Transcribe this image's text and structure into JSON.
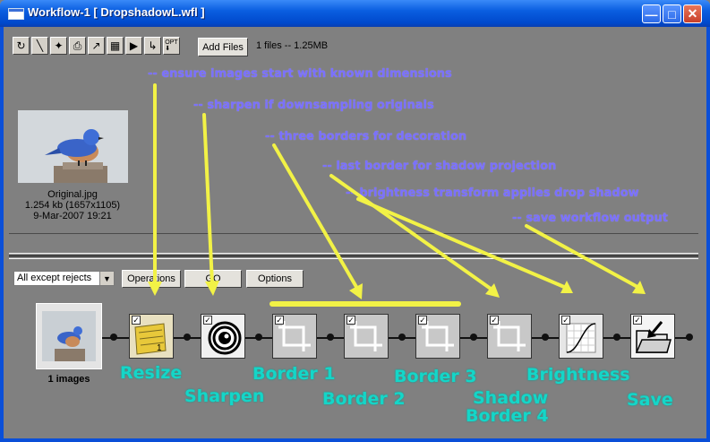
{
  "window": {
    "title": "Workflow-1 [ DropshadowL.wfl ]",
    "controls": [
      "minimize-icon",
      "maximize-icon",
      "close-icon"
    ]
  },
  "toolbar": {
    "tools": [
      "refresh-icon",
      "wand-icon",
      "tools-icon",
      "print-icon",
      "export-icon",
      "trash-icon",
      "play-icon",
      "step-icon",
      "options-icon"
    ],
    "add_files_label": "Add Files",
    "file_count": "1 files -- 1.25MB"
  },
  "annotations": [
    "-- ensure images start with known dimensions",
    "-- sharpen if downsampling originals",
    "-- three borders for decoration",
    "-- last border for shadow projection",
    "-- brightness transform applies drop shadow",
    "-- save workflow output"
  ],
  "preview": {
    "filename": "Original.jpg",
    "size": "1.254 kb (1657x1105)",
    "date": "9-Mar-2007 19:21"
  },
  "controls": {
    "filter_value": "All except rejects",
    "operations_label": "Operations",
    "go_label": "GO",
    "options_label": "Options"
  },
  "workflow": {
    "source_label": "1 images",
    "steps": [
      {
        "label": "Resize",
        "icon": "ruler-icon",
        "checked": true
      },
      {
        "label": "Sharpen",
        "icon": "sharpen-icon",
        "checked": true
      },
      {
        "label": "Border 1",
        "icon": "border-icon",
        "checked": true
      },
      {
        "label": "Border 2",
        "icon": "border-icon",
        "checked": true
      },
      {
        "label": "Border 3",
        "icon": "border-icon",
        "checked": true
      },
      {
        "label": "Shadow",
        "label2": "Border 4",
        "icon": "border-icon",
        "checked": true
      },
      {
        "label": "Brightness",
        "icon": "curve-icon",
        "checked": true
      },
      {
        "label": "Save",
        "icon": "save-folder-icon",
        "checked": true
      }
    ]
  },
  "colors": {
    "annotation_text": "#7a70ff",
    "step_label": "#14d6c8",
    "arrow": "#f2f246",
    "titlebar": "#0a5ee0"
  }
}
